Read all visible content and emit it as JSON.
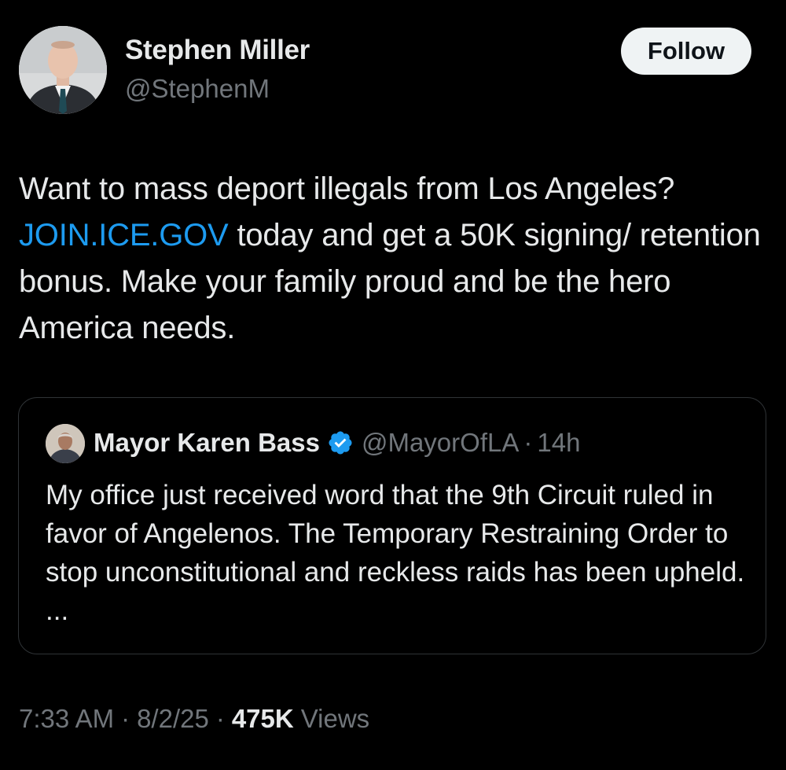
{
  "author": {
    "name": "Stephen Miller",
    "handle": "@StephenM",
    "avatar_icon": "person-avatar"
  },
  "follow_button": {
    "label": "Follow"
  },
  "tweet": {
    "text_part1": "Want to mass deport illegals from Los Angeles? ",
    "link_text": "JOIN.ICE.GOV",
    "text_part2": " today and get a 50K signing/ retention bonus. Make your family proud and be the hero America needs.",
    "link_color": "#1d9bf0"
  },
  "quoted_tweet": {
    "author_name": "Mayor Karen Bass",
    "verified_icon": "verified-badge-icon",
    "verified_color": "#1d9bf0",
    "handle": "@MayorOfLA",
    "separator": "·",
    "time": "14h",
    "text": "My office just received word that the 9th Circuit ruled in favor of Angelenos. The Temporary Restraining Order to stop unconstitutional and reckless raids has been upheld. ..."
  },
  "meta": {
    "time": "7:33 AM",
    "separator": "·",
    "date": "8/2/25",
    "views_count": "475K",
    "views_label": "Views"
  },
  "colors": {
    "background": "#000000",
    "primary_text": "#e7e9ea",
    "secondary_text": "#71767b",
    "border": "#2f3336"
  }
}
